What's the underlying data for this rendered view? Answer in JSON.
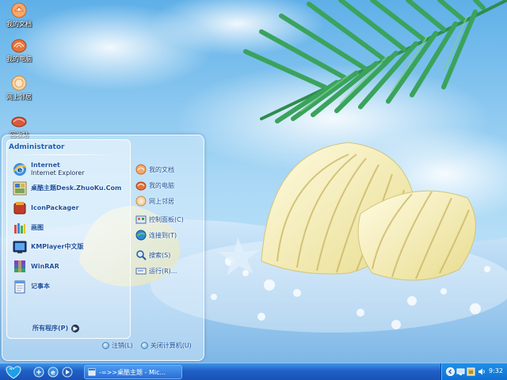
{
  "desktop": {
    "icons": [
      {
        "label": "我的文档",
        "icon": "documents-shell-icon"
      },
      {
        "label": "我的电脑",
        "icon": "computer-shell-icon"
      },
      {
        "label": "网上邻居",
        "icon": "network-shell-icon"
      },
      {
        "label": "回收站",
        "icon": "recycle-shell-icon"
      }
    ]
  },
  "start_menu": {
    "user": "Administrator",
    "pinned": [
      {
        "title": "Internet",
        "subtitle": "Internet Explorer",
        "icon": "ie-icon"
      },
      {
        "title": "桌酷主题Desk.ZhuoKu.Com",
        "subtitle": "",
        "icon": "zhuoku-icon"
      }
    ],
    "recent": [
      {
        "title": "IconPackager",
        "icon": "iconpackager-icon"
      },
      {
        "title": "画图",
        "icon": "paint-icon"
      },
      {
        "title": "KMPlayer中文版",
        "icon": "kmplayer-icon"
      },
      {
        "title": "WinRAR",
        "icon": "winrar-icon"
      },
      {
        "title": "记事本",
        "icon": "notepad-icon"
      }
    ],
    "all_programs": "所有程序(P)",
    "places": [
      {
        "label": "我的文档",
        "icon": "documents-icon"
      },
      {
        "label": "我的电脑",
        "icon": "computer-icon"
      },
      {
        "label": "网上邻居",
        "icon": "network-icon"
      },
      {
        "label": "控制面板(C)",
        "icon": "control-panel-icon"
      },
      {
        "label": "连接到(T)",
        "icon": "connect-icon"
      },
      {
        "label": "搜索(S)",
        "icon": "search-icon"
      },
      {
        "label": "运行(R)...",
        "icon": "run-icon"
      }
    ],
    "logoff": "注销(L)",
    "shutdown": "关闭计算机(U)"
  },
  "taskbar": {
    "task": "-=>>桌酷主题 - Mic...",
    "clock": "9:32"
  },
  "colors": {
    "taskbar": "#2060c8",
    "accent": "#1a4f9c",
    "sky": "#8cc6ec"
  }
}
